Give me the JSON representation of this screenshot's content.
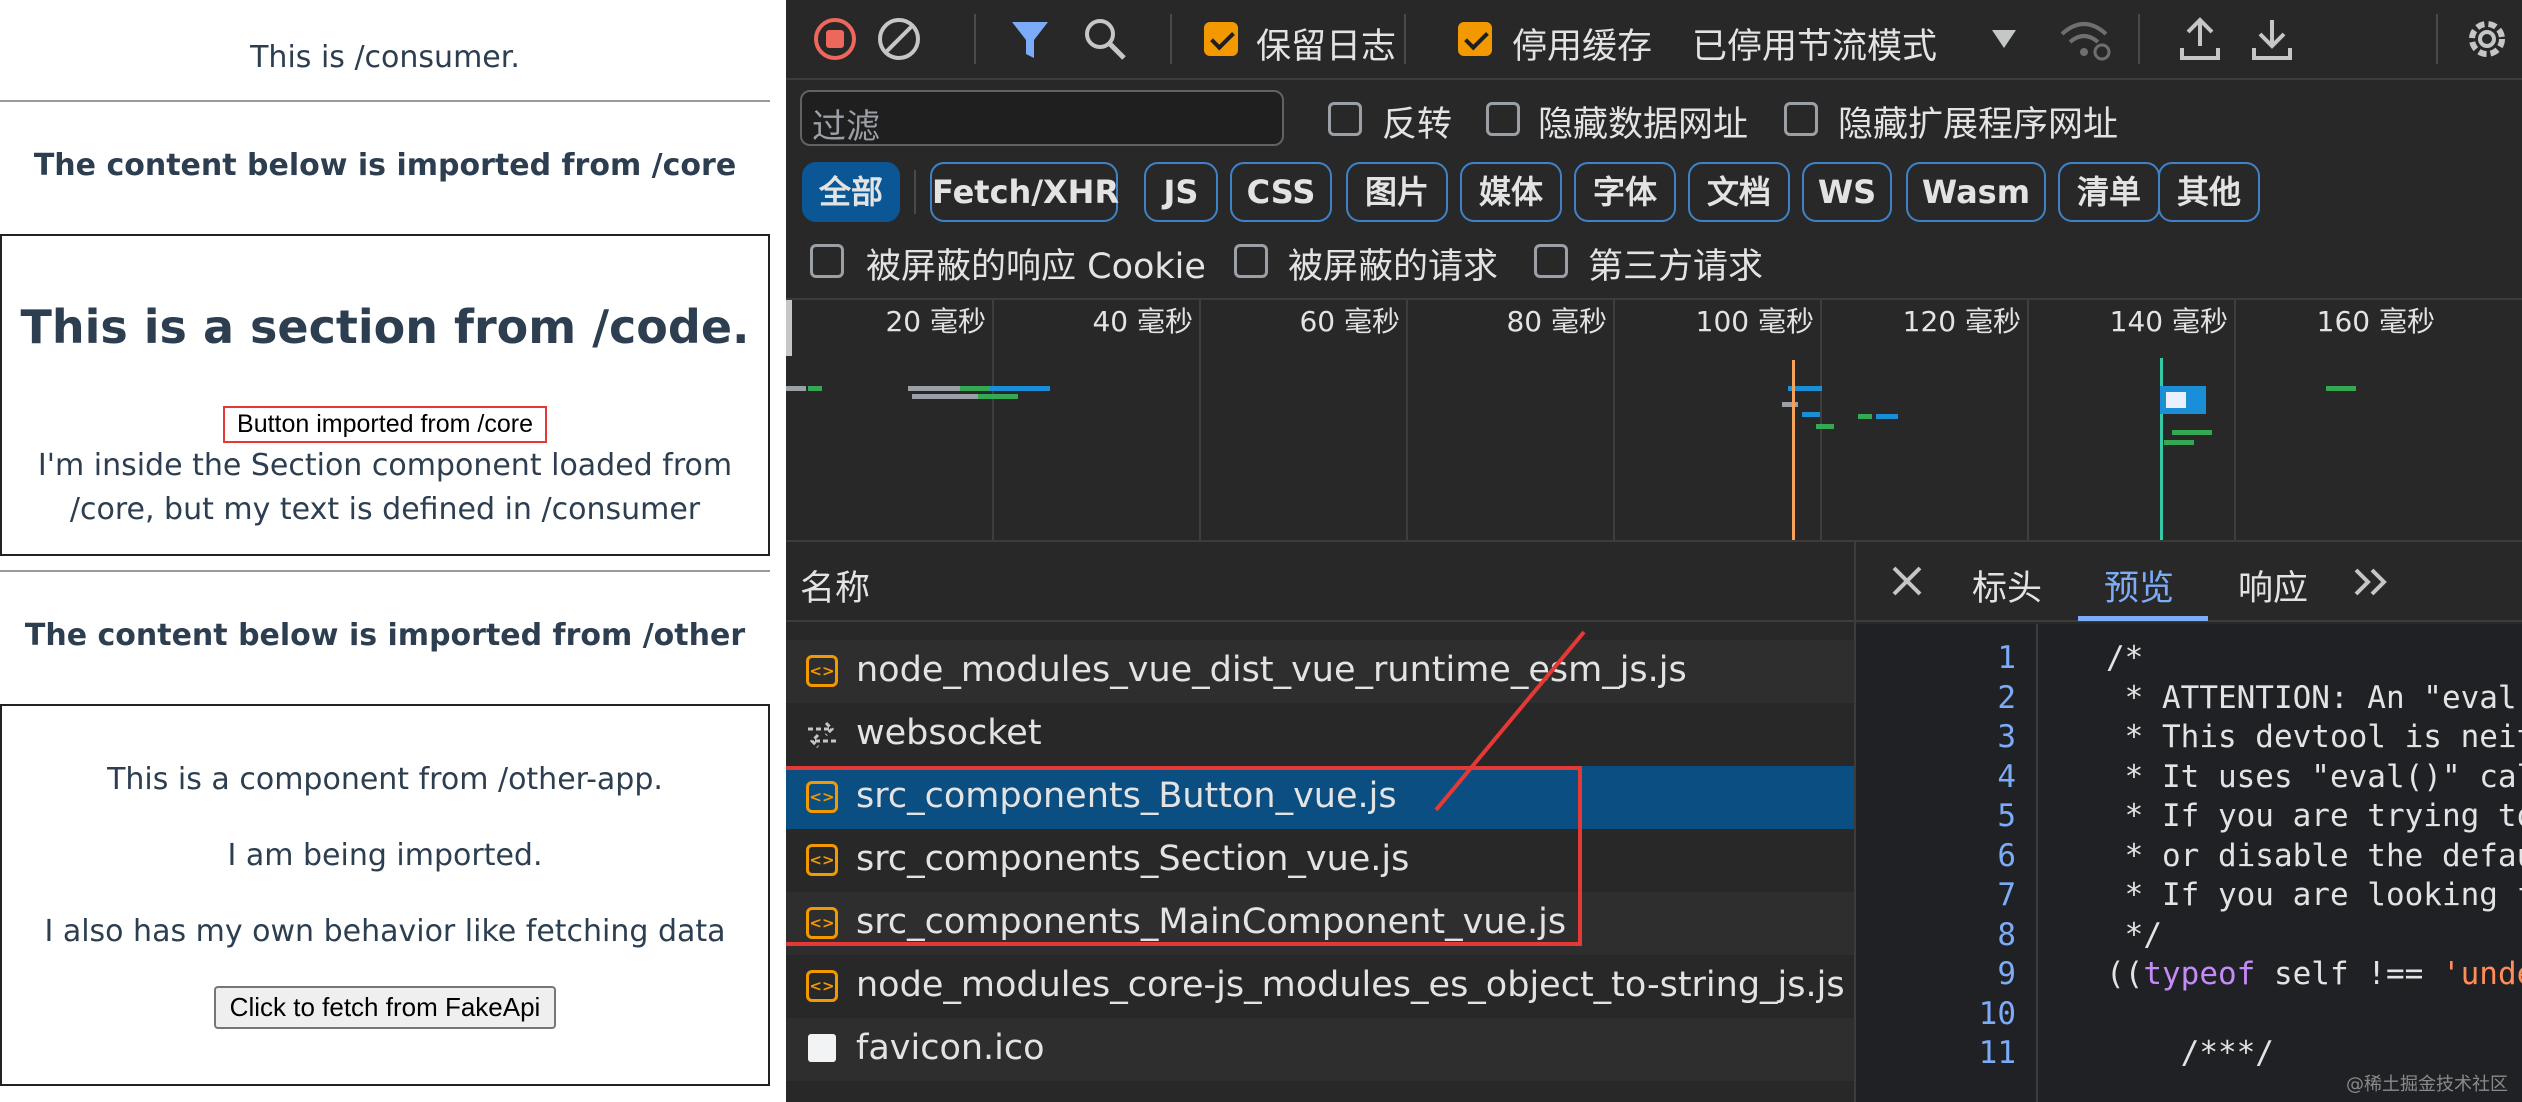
{
  "consumer_page": {
    "intro": "This is /consumer.",
    "core_heading": "The content below is imported from /core",
    "section_title": "This is a section from /code.",
    "core_button": "Button imported from /core",
    "section_text_1": "I'm inside the Section component loaded from",
    "section_text_2": "/core, but my text is defined in /consumer",
    "other_heading": "The content below is imported from /other",
    "other_line_1": "This is a component from /other-app.",
    "other_line_2": "I am being imported.",
    "other_line_3": "I also has my own behavior like fetching data",
    "fetch_button": "Click to fetch from FakeApi"
  },
  "devtools": {
    "toolbar": {
      "preserve_log": "保留日志",
      "preserve_log_checked": true,
      "disable_cache": "停用缓存",
      "disable_cache_checked": true,
      "throttling": "已停用节流模式",
      "icons": [
        "record-stop-icon",
        "clear-icon",
        "filter-icon",
        "search-icon",
        "chevron-down-icon",
        "wifi-settings-icon",
        "upload-icon",
        "download-icon",
        "gear-icon"
      ]
    },
    "filter": {
      "placeholder": "过滤",
      "invert": "反转",
      "hide_data_urls": "隐藏数据网址",
      "hide_extension_urls": "隐藏扩展程序网址"
    },
    "type_filters": [
      "全部",
      "Fetch/XHR",
      "JS",
      "CSS",
      "图片",
      "媒体",
      "字体",
      "文档",
      "WS",
      "Wasm",
      "清单",
      "其他"
    ],
    "type_filter_active": "全部",
    "checkboxes": {
      "blocked_cookies": "被屏蔽的响应 Cookie",
      "blocked_requests": "被屏蔽的请求",
      "third_party": "第三方请求"
    },
    "timeline_ticks": [
      "20 毫秒",
      "40 毫秒",
      "60 毫秒",
      "80 毫秒",
      "100 毫秒",
      "120 毫秒",
      "140 毫秒",
      "160 毫秒"
    ],
    "requests_header": "名称",
    "requests": [
      {
        "name": "node_modules_vue_dist_vue_runtime_esm_js.js",
        "icon": "script-icon"
      },
      {
        "name": "websocket",
        "icon": "websocket-icon"
      },
      {
        "name": "src_components_Button_vue.js",
        "icon": "script-icon",
        "selected": true
      },
      {
        "name": "src_components_Section_vue.js",
        "icon": "script-icon"
      },
      {
        "name": "src_components_MainComponent_vue.js",
        "icon": "script-icon"
      },
      {
        "name": "node_modules_core-js_modules_es_object_to-string_js.js",
        "icon": "script-icon"
      },
      {
        "name": "favicon.ico",
        "icon": "document-icon"
      }
    ],
    "detail_tabs": [
      "标头",
      "预览",
      "响应"
    ],
    "detail_tab_active": "预览",
    "code_lines": [
      {
        "n": "1",
        "text": "/*"
      },
      {
        "n": "2",
        "text": " * ATTENTION: An \"eval-so"
      },
      {
        "n": "3",
        "text": " * This devtool is neithe"
      },
      {
        "n": "4",
        "text": " * It uses \"eval()\" calls"
      },
      {
        "n": "5",
        "text": " * If you are trying to r"
      },
      {
        "n": "6",
        "text": " * or disable the defaul"
      },
      {
        "n": "7",
        "text": " * If you are looking for"
      },
      {
        "n": "8",
        "text": " */"
      },
      {
        "n": "9",
        "kw": "typeof",
        "pre": "((",
        "mid": " self !== ",
        "str": "'undefi"
      },
      {
        "n": "10",
        "text": ""
      },
      {
        "n": "11",
        "text": "    /***/"
      }
    ],
    "watermark": "@稀土掘金技术社区",
    "colors": {
      "accent": "#0b5796",
      "highlight": "#e53935",
      "checkbox": "#f29900",
      "line_numbers": "#7cacf8"
    }
  }
}
